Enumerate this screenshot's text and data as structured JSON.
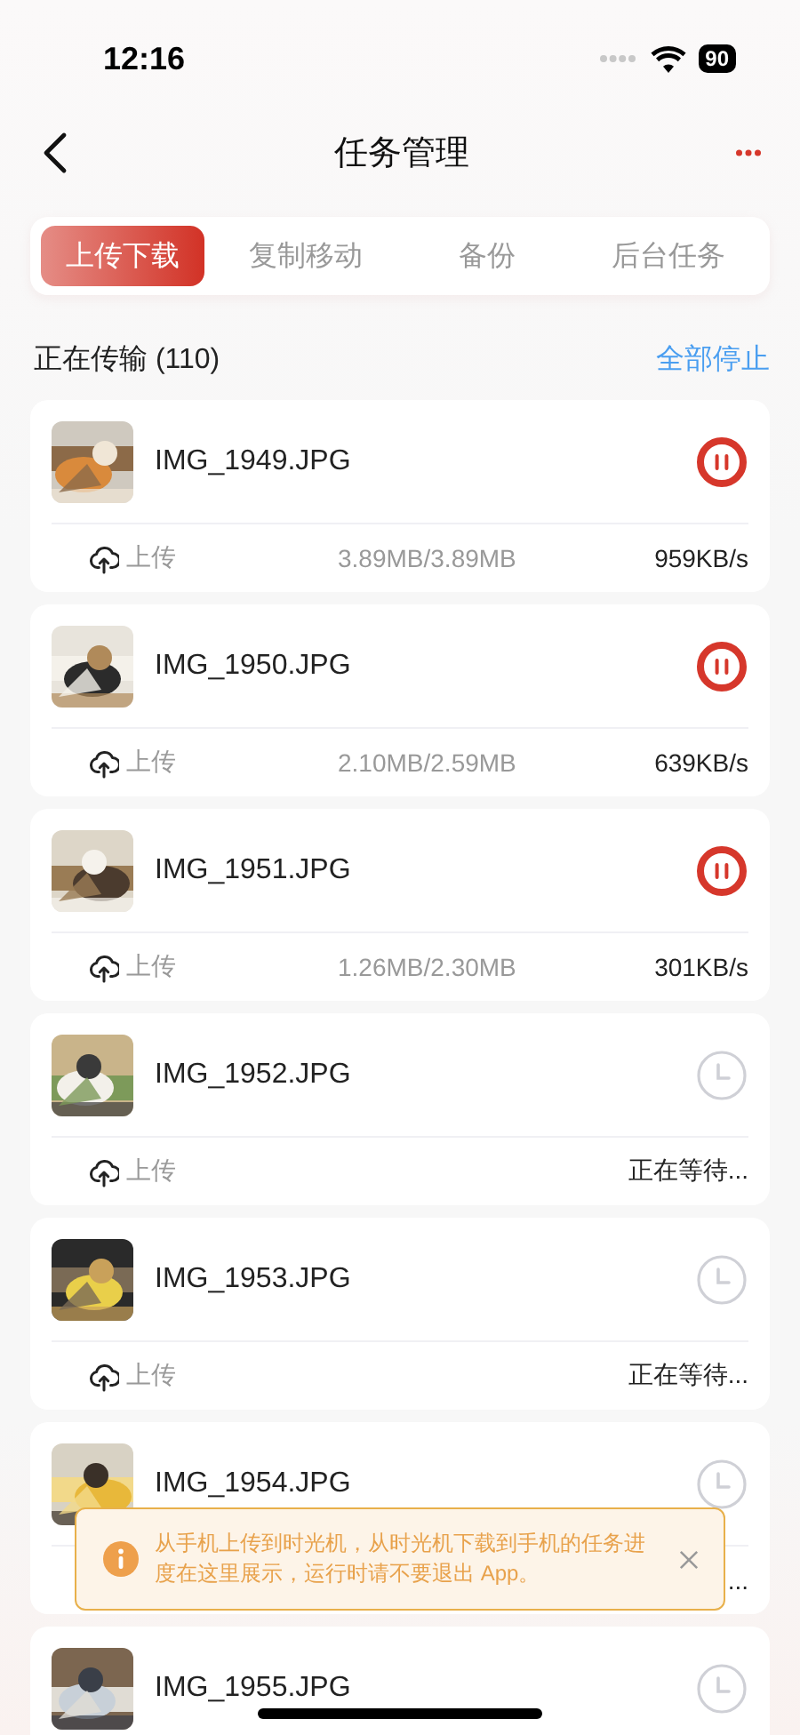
{
  "status_bar": {
    "time": "12:16",
    "battery": "90"
  },
  "nav": {
    "title": "任务管理"
  },
  "tabs": [
    {
      "label": "上传下载",
      "selected": true
    },
    {
      "label": "复制移动",
      "selected": false
    },
    {
      "label": "备份",
      "selected": false
    },
    {
      "label": "后台任务",
      "selected": false
    }
  ],
  "section": {
    "title": "正在传输 (110)",
    "action": "全部停止"
  },
  "transfers": [
    {
      "name": "IMG_1949.JPG",
      "kind": "uploading",
      "direction": "上传",
      "size": "3.89MB/3.89MB",
      "status": "959KB/s"
    },
    {
      "name": "IMG_1950.JPG",
      "kind": "uploading",
      "direction": "上传",
      "size": "2.10MB/2.59MB",
      "status": "639KB/s"
    },
    {
      "name": "IMG_1951.JPG",
      "kind": "uploading",
      "direction": "上传",
      "size": "1.26MB/2.30MB",
      "status": "301KB/s"
    },
    {
      "name": "IMG_1952.JPG",
      "kind": "waiting",
      "direction": "上传",
      "status": "正在等待..."
    },
    {
      "name": "IMG_1953.JPG",
      "kind": "waiting",
      "direction": "上传",
      "status": "正在等待..."
    },
    {
      "name": "IMG_1954.JPG",
      "kind": "waiting",
      "status": "..."
    },
    {
      "name": "IMG_1955.JPG",
      "kind": "waiting"
    }
  ],
  "toast": {
    "message": "从手机上传到时光机，从时光机下载到手机的任务进度在这里展示，运行时请不要退出 App。"
  }
}
